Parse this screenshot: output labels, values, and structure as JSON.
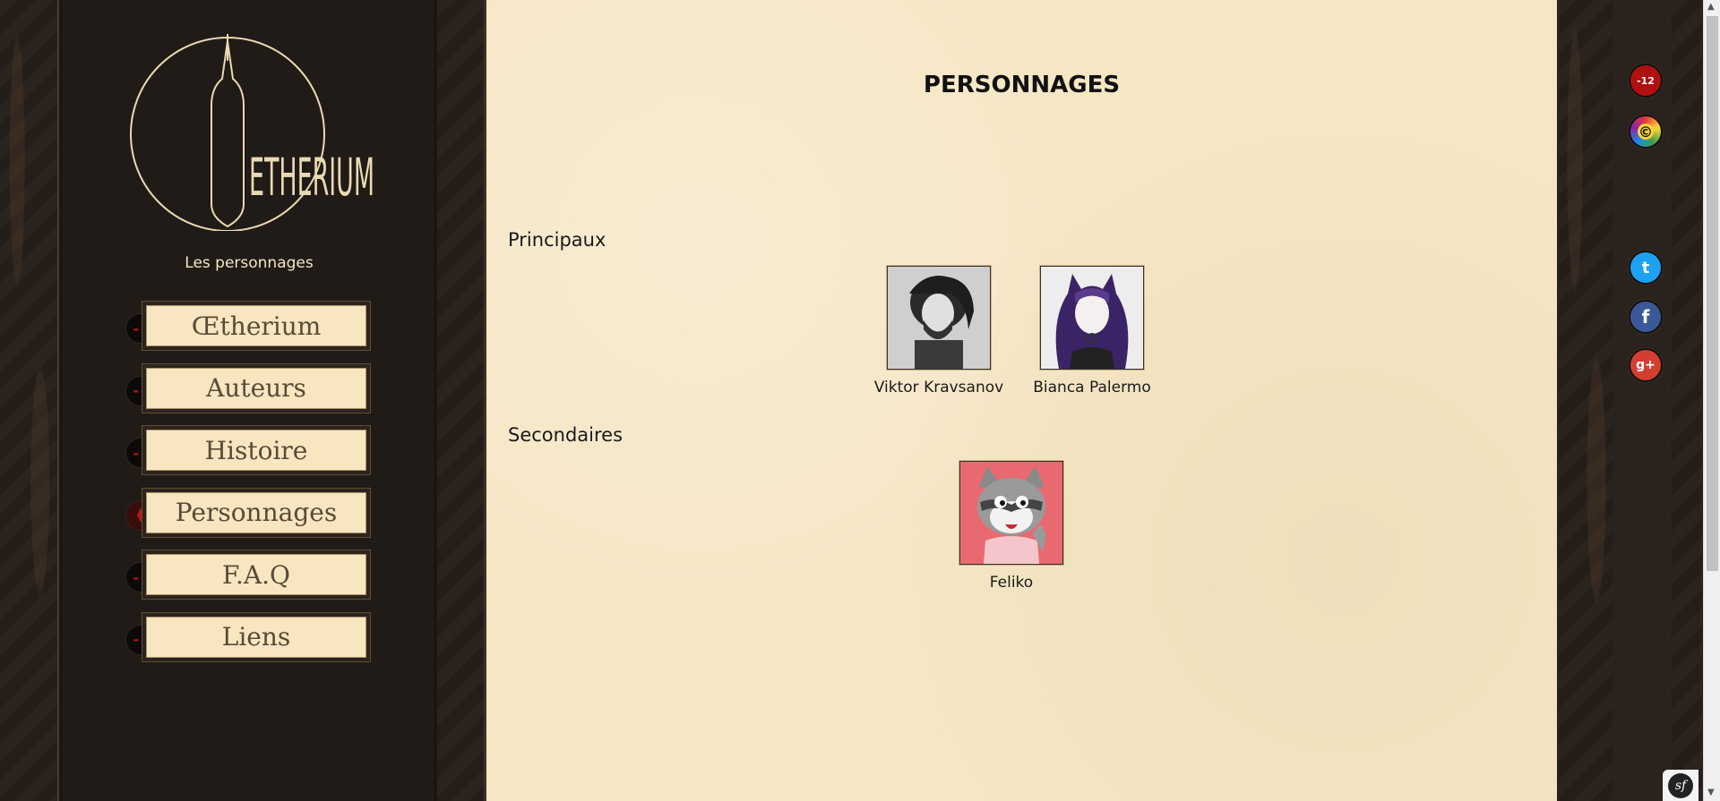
{
  "brand": {
    "logo_text": "ETHERIUM",
    "subtitle": "Les personnages"
  },
  "nav": {
    "items": [
      {
        "label": "Œtherium",
        "active": false
      },
      {
        "label": "Auteurs",
        "active": false
      },
      {
        "label": "Histoire",
        "active": false
      },
      {
        "label": "Personnages",
        "active": true
      },
      {
        "label": "F.A.Q",
        "active": false
      },
      {
        "label": "Liens",
        "active": false
      }
    ]
  },
  "main": {
    "title": "PERSONNAGES",
    "sections": [
      {
        "title": "Principaux",
        "characters": [
          {
            "name": "Viktor Kravsanov",
            "portrait": "viktor-portrait"
          },
          {
            "name": "Bianca Palermo",
            "portrait": "bianca-portrait"
          }
        ]
      },
      {
        "title": "Secondaires",
        "characters": [
          {
            "name": "Feliko",
            "portrait": "feliko-portrait"
          }
        ]
      }
    ]
  },
  "social": [
    {
      "name": "age-rating-icon",
      "color": "#b01010",
      "glyph": "-12"
    },
    {
      "name": "copyright-icon",
      "color": "#6a2aa0",
      "glyph": "©"
    },
    {
      "name": "twitter-icon",
      "color": "#1da1f2",
      "glyph": "t"
    },
    {
      "name": "facebook-icon",
      "color": "#3b5998",
      "glyph": "f"
    },
    {
      "name": "googleplus-icon",
      "color": "#d23f31",
      "glyph": "g+"
    }
  ],
  "debug_toolbar": {
    "glyph": "sf"
  },
  "colors": {
    "parchment": "#f5e6c4",
    "sidebar": "#211b17",
    "nav_face": "#f7e6bf",
    "accent_red": "#b01a1a"
  }
}
